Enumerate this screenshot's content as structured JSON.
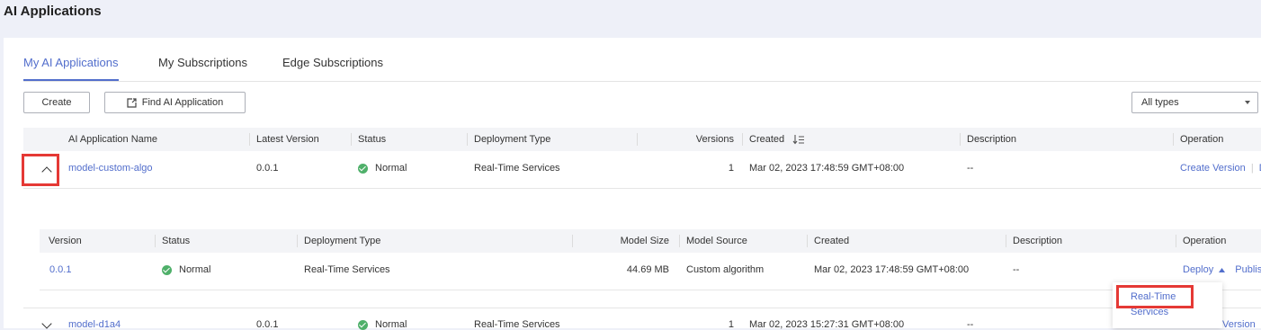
{
  "page": {
    "title": "AI Applications"
  },
  "tabs": [
    {
      "label": "My AI Applications",
      "active": true
    },
    {
      "label": "My Subscriptions",
      "active": false
    },
    {
      "label": "Edge Subscriptions",
      "active": false
    }
  ],
  "toolbar": {
    "create_label": "Create",
    "find_label": "Find AI Application",
    "type_filter": "All types"
  },
  "main_table": {
    "headers": [
      "AI Application Name",
      "Latest Version",
      "Status",
      "Deployment Type",
      "Versions",
      "Created",
      "Description",
      "Operation"
    ],
    "rows": [
      {
        "name": "model-custom-algo",
        "latest_version": "0.0.1",
        "status": "Normal",
        "deployment_type": "Real-Time Services",
        "versions": "1",
        "created": "Mar 02, 2023 17:48:59 GMT+08:00",
        "description": "--",
        "operation_1": "Create Version",
        "operation_2": "D",
        "expanded": true
      },
      {
        "name": "model-d1a4",
        "latest_version": "0.0.1",
        "status": "Normal",
        "deployment_type": "Real-Time Services",
        "versions": "1",
        "created": "Mar 02, 2023 15:27:31 GMT+08:00",
        "description": "--",
        "operation_1": "Version",
        "expanded": false
      }
    ]
  },
  "version_table": {
    "headers": [
      "Version",
      "Status",
      "Deployment Type",
      "Model Size",
      "Model Source",
      "Created",
      "Description",
      "Operation"
    ],
    "rows": [
      {
        "version": "0.0.1",
        "status": "Normal",
        "deployment_type": "Real-Time Services",
        "model_size": "44.69 MB",
        "model_source": "Custom algorithm",
        "created": "Mar 02, 2023 17:48:59 GMT+08:00",
        "description": "--",
        "deploy_label": "Deploy",
        "publish_label": "Publish"
      }
    ]
  },
  "deploy_menu": {
    "items": [
      {
        "label": "Real-Time Services",
        "highlighted": true
      }
    ]
  },
  "colors": {
    "accent": "#526ecc",
    "success": "#4fb06a",
    "highlight": "#e53935"
  },
  "icons": [
    "find-icon",
    "chevron-down-icon",
    "chevron-up-icon",
    "sort-icon",
    "check-circle-icon",
    "caret-up-icon"
  ]
}
